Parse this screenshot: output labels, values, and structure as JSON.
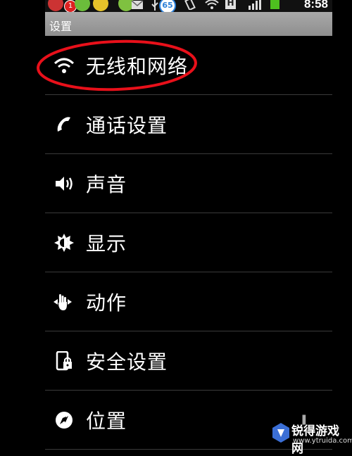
{
  "status_bar": {
    "notification_count": "1",
    "battery_level": "65",
    "network_type": "H",
    "time": "8:58"
  },
  "header": {
    "title": "设置"
  },
  "settings_items": [
    {
      "label": "无线和网络",
      "icon": "wifi-icon"
    },
    {
      "label": "通话设置",
      "icon": "phone-icon"
    },
    {
      "label": "声音",
      "icon": "speaker-icon"
    },
    {
      "label": "显示",
      "icon": "brightness-icon"
    },
    {
      "label": "动作",
      "icon": "hand-gesture-icon"
    },
    {
      "label": "安全设置",
      "icon": "lock-phone-icon"
    },
    {
      "label": "位置",
      "icon": "compass-icon"
    }
  ],
  "watermark": {
    "name": "锐得游戏网",
    "url": "www.ytruida.com"
  },
  "colors": {
    "annotation": "#e8101a",
    "title_bar": "#9a9a9a",
    "background": "#000000"
  }
}
